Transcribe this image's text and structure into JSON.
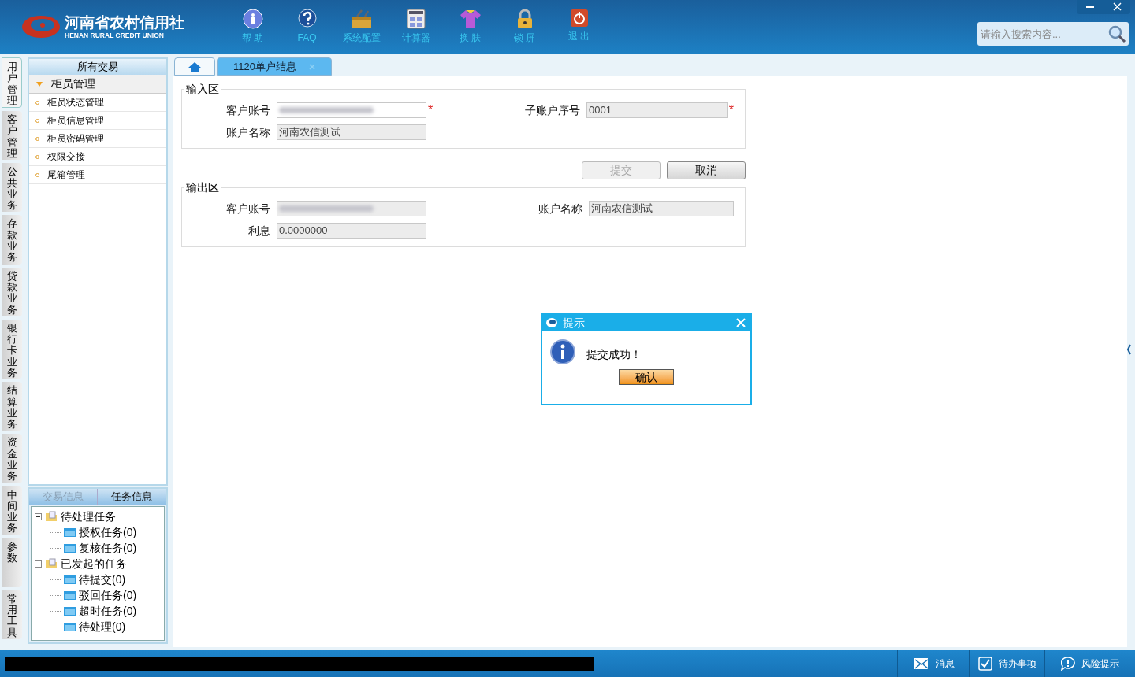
{
  "header": {
    "logo_title": "河南省农村信用社",
    "logo_subtitle": "HENAN RURAL CREDIT UNION",
    "toolbar": [
      {
        "kind": "help",
        "label": "帮 助"
      },
      {
        "kind": "faq",
        "label": "FAQ"
      },
      {
        "kind": "config",
        "label": "系统配置"
      },
      {
        "kind": "calculator",
        "label": "计算器"
      },
      {
        "kind": "skin",
        "label": "换 肤"
      },
      {
        "kind": "lock",
        "label": "锁 屏"
      },
      {
        "kind": "exit",
        "label": "退 出"
      }
    ],
    "search": {
      "placeholder": "请输入搜索内容..."
    }
  },
  "side_tabs": [
    {
      "label": "用户管理",
      "selected": true
    },
    {
      "label": "客户管理",
      "selected": false
    },
    {
      "label": "公共业务",
      "selected": false
    },
    {
      "label": "存款业务",
      "selected": false
    },
    {
      "label": "贷款业务",
      "selected": false
    },
    {
      "label": "银行卡业务",
      "selected": false
    },
    {
      "label": "结算业务",
      "selected": false
    },
    {
      "label": "资金业务",
      "selected": false
    },
    {
      "label": "中间业务",
      "selected": false
    },
    {
      "label": "参数",
      "selected": false
    },
    {
      "label": "常用工具",
      "selected": false
    }
  ],
  "sidebar": {
    "title": "所有交易",
    "group": {
      "label": "柜员管理",
      "expanded": true,
      "items": [
        "柜员状态管理",
        "柜员信息管理",
        "柜员密码管理",
        "权限交接",
        "尾箱管理"
      ]
    }
  },
  "bottom_panel": {
    "tabs": [
      {
        "label": "交易信息",
        "selected": false
      },
      {
        "label": "任务信息",
        "selected": true
      }
    ],
    "tree": [
      {
        "label": "待处理任务",
        "expanded": true,
        "children": [
          {
            "label": "授权任务(0)"
          },
          {
            "label": "复核任务(0)"
          }
        ]
      },
      {
        "label": "已发起的任务",
        "expanded": true,
        "children": [
          {
            "label": "待提交(0)"
          },
          {
            "label": "驳回任务(0)"
          },
          {
            "label": "超时任务(0)"
          },
          {
            "label": "待处理(0)"
          }
        ]
      }
    ]
  },
  "tabs": [
    {
      "kind": "home",
      "selected": false
    },
    {
      "kind": "page",
      "label": "1120单户结息",
      "selected": true
    }
  ],
  "input_area": {
    "title": "输入区",
    "fields": [
      {
        "label": "客户账号",
        "redacted": true,
        "editable": true,
        "required_mark": "*"
      },
      {
        "label": "子账户序号",
        "value": "0001",
        "redacted": false,
        "editable": false,
        "required_mark": "*"
      },
      {
        "label": "账户名称",
        "value": "河南农信测试",
        "redacted": false,
        "editable": false
      }
    ]
  },
  "buttons": [
    {
      "label": "提交",
      "disabled": true
    },
    {
      "label": "取消",
      "disabled": false
    }
  ],
  "output_area": {
    "title": "输出区",
    "fields": [
      {
        "label": "客户账号",
        "redacted": true,
        "editable": false
      },
      {
        "label": "账户名称",
        "value": "河南农信测试",
        "redacted": false,
        "editable": false
      },
      {
        "label": "利息",
        "value": "0.0000000",
        "redacted": false,
        "editable": false
      }
    ]
  },
  "dialog": {
    "title": "提示",
    "message": "提交成功！",
    "button": "确认"
  },
  "status_bar": [
    {
      "kind": "mail",
      "label": "消息"
    },
    {
      "kind": "check",
      "label": "待办事项"
    },
    {
      "kind": "chat",
      "label": "风险提示"
    }
  ]
}
